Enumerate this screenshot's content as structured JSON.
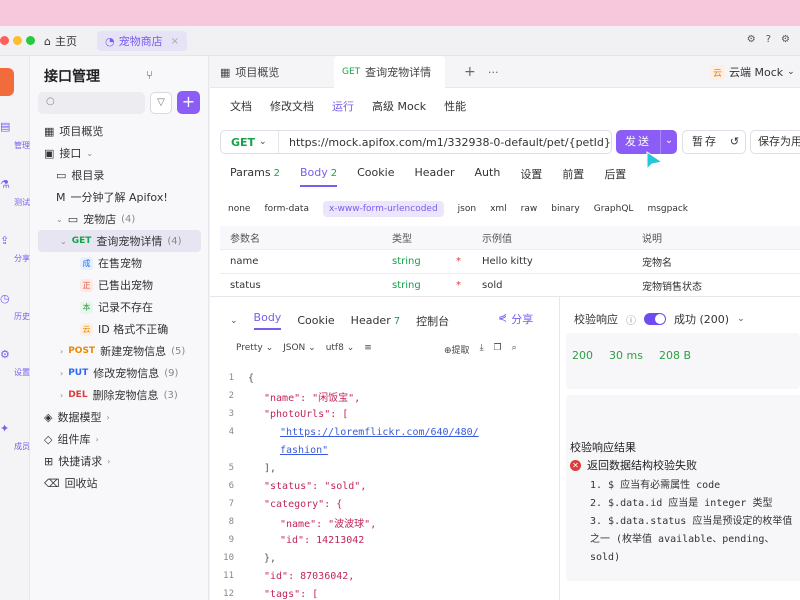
{
  "titlebar": {
    "home_tab": "主页",
    "shop_tab": "宠物商店",
    "shop_close": "×"
  },
  "rail": {
    "items": [
      "管理",
      "测试",
      "分享",
      "历史",
      "设置",
      "成员"
    ]
  },
  "sidebar": {
    "title": "接口管理",
    "search_placeholder": "",
    "add_label": "+",
    "tree": {
      "overview": "项目概览",
      "interfaces": "接口",
      "root": "根目录",
      "intro": "一分钟了解 Apifox!",
      "folder": "宠物店",
      "folder_count": "(4)",
      "selected_method": "GET",
      "selected_label": "查询宠物详情",
      "selected_count": "(4)",
      "cases": [
        {
          "icon": "成",
          "label": "在售宠物"
        },
        {
          "icon": "正",
          "label": "已售出宠物"
        },
        {
          "icon": "本",
          "label": "记录不存在"
        },
        {
          "icon": "云",
          "label": "ID 格式不正确"
        }
      ],
      "endpoints": [
        {
          "method": "POST",
          "label": "新建宠物信息",
          "count": "(5)"
        },
        {
          "method": "PUT",
          "label": "修改宠物信息",
          "count": "(9)"
        },
        {
          "method": "DEL",
          "label": "删除宠物信息",
          "count": "(3)"
        }
      ],
      "models": "数据模型",
      "components": "组件库",
      "quick_requests": "快捷请求",
      "trash": "回收站"
    }
  },
  "doctabs": {
    "overview": "项目概览",
    "active_method": "GET",
    "active_label": "查询宠物详情",
    "add": "+",
    "more": "···",
    "env": "云端 Mock"
  },
  "subnav": [
    "文档",
    "修改文档",
    "运行",
    "高级 Mock",
    "性能"
  ],
  "request": {
    "method": "GET",
    "url": "https://mock.apifox.com/m1/332938-0-default/pet/{petId}",
    "send": "发送",
    "save_temp": "暂存",
    "save_as": "保存为用"
  },
  "reqtabs": [
    {
      "label": "Params",
      "badge": "2"
    },
    {
      "label": "Body",
      "badge": "2"
    },
    {
      "label": "Cookie",
      "badge": ""
    },
    {
      "label": "Header",
      "badge": ""
    },
    {
      "label": "Auth",
      "badge": ""
    },
    {
      "label": "设置",
      "badge": ""
    },
    {
      "label": "前置",
      "badge": ""
    },
    {
      "label": "后置",
      "badge": ""
    }
  ],
  "body_types": [
    "none",
    "form-data",
    "x-www-form-urlencoded",
    "json",
    "xml",
    "raw",
    "binary",
    "GraphQL",
    "msgpack"
  ],
  "params_table": {
    "headers": [
      "参数名",
      "类型",
      "示例值",
      "说明"
    ],
    "rows": [
      {
        "name": "name",
        "type": "string",
        "example": "Hello kitty",
        "desc": "宠物名"
      },
      {
        "name": "status",
        "type": "string",
        "example": "sold",
        "desc": "宠物销售状态"
      }
    ]
  },
  "response": {
    "tabs": [
      {
        "label": "Body",
        "badge": ""
      },
      {
        "label": "Cookie",
        "badge": ""
      },
      {
        "label": "Header",
        "badge": "7"
      },
      {
        "label": "控制台",
        "badge": ""
      }
    ],
    "share": "分享",
    "format": [
      "Pretty",
      "JSON",
      "utf8"
    ],
    "extract": "提取"
  },
  "code_lines": [
    {
      "n": "1",
      "t": "{"
    },
    {
      "n": "2",
      "t": "\"name\": \"闲饭宝\","
    },
    {
      "n": "3",
      "t": "\"photoUrls\": ["
    },
    {
      "n": "4",
      "t": "\"https://loremflickr.com/640/480/"
    },
    {
      "n": "",
      "t": "fashion\""
    },
    {
      "n": "5",
      "t": "],"
    },
    {
      "n": "6",
      "t": "\"status\": \"sold\","
    },
    {
      "n": "7",
      "t": "\"category\": {"
    },
    {
      "n": "8",
      "t": "\"name\": \"波波球\","
    },
    {
      "n": "9",
      "t": "\"id\": 14213042"
    },
    {
      "n": "10",
      "t": "},"
    },
    {
      "n": "11",
      "t": "\"id\": 87036042,"
    },
    {
      "n": "12",
      "t": "\"tags\": ["
    }
  ],
  "validation": {
    "label": "校验响应",
    "result": "成功 (200)",
    "status_code": "200",
    "time": "30 ms",
    "size": "208 B",
    "title": "校验响应结果",
    "error": "返回数据结构校验失败",
    "items": [
      "1. $ 应当有必需属性 code",
      "2. $.data.id 应当是 integer 类型",
      "3. $.data.status 应当是预设定的枚举值之一 (枚举值 available、pending、sold)"
    ]
  },
  "colors": {
    "accent": "#8b5cf6",
    "get": "#15a34a",
    "post": "#e68a00",
    "put": "#2a6cf0",
    "del": "#e03b3b"
  }
}
